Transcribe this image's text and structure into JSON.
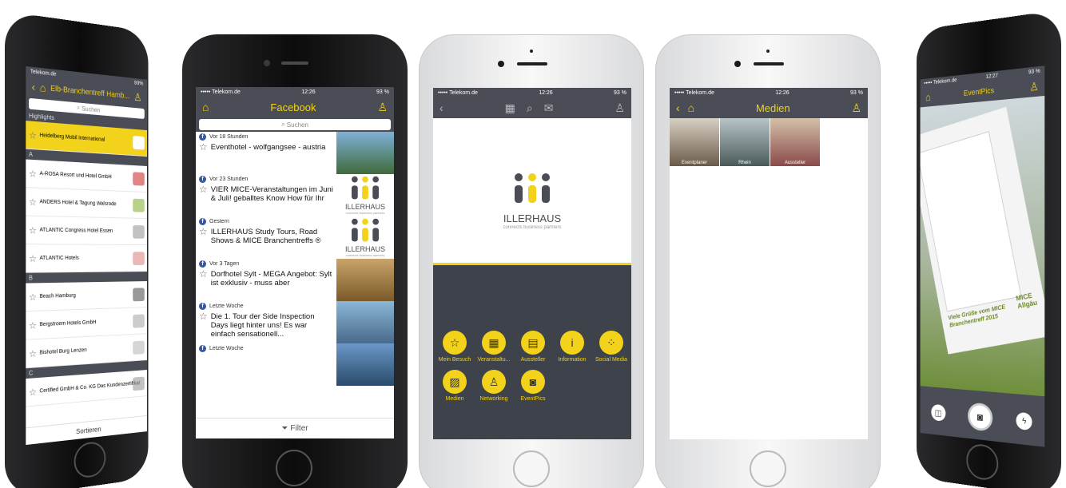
{
  "phone1": {
    "status_carrier": "Telekom.de",
    "status_battery": "93%",
    "nav_title": "Elb-Branchentreff Hamb...",
    "search_placeholder": "Suchen",
    "sections": [
      {
        "header": "Highlights",
        "items": [
          {
            "name": "Heidelberg Mobil International",
            "selected": true
          }
        ]
      },
      {
        "header": "A",
        "items": [
          {
            "name": "A-ROSA Resort und Hotel GmbH"
          },
          {
            "name": "ANDERS Hotel & Tagung Walsrode"
          },
          {
            "name": "ATLANTIC Congress Hotel Essen"
          },
          {
            "name": "ATLANTIC Hotels"
          }
        ]
      },
      {
        "header": "B",
        "items": [
          {
            "name": "Beach Hamburg"
          },
          {
            "name": "Bergstroem Hotels GmbH"
          },
          {
            "name": "Bishotel Burg Lenzen"
          }
        ]
      },
      {
        "header": "C",
        "items": [
          {
            "name": "Certified GmbH & Co. KG Das Kundenzertifikat"
          }
        ]
      }
    ],
    "footer": "Sortieren"
  },
  "phone2": {
    "status_carrier": "••••• Telekom.de",
    "status_time": "12:26",
    "status_battery": "93 %",
    "nav_title": "Facebook",
    "search_placeholder": "Suchen",
    "posts": [
      {
        "time": "Vor 18 Stunden",
        "text": "Eventhotel - wolfgangsee - austria"
      },
      {
        "time": "Vor 23 Stunden",
        "text": "VIER MICE-Veranstaltungen im Juni & Juli! geballtes Know How für Ihr"
      },
      {
        "time": "Gestern",
        "text": "ILLERHAUS Study Tours, Road Shows & MICE Branchentreffs ®"
      },
      {
        "time": "Vor 3 Tagen",
        "text": "Dorfhotel Sylt - MEGA Angebot: Sylt ist exklusiv - muss aber"
      },
      {
        "time": "Letzte Woche",
        "text": "Die 1. Tour der Side Inspection Days liegt hinter uns! Es war einfach sensationell..."
      },
      {
        "time": "Letzte Woche",
        "text": ""
      }
    ],
    "logo_text": "ILLERHAUS",
    "logo_sub": "connects business partners",
    "filter_label": "Filter"
  },
  "phone3": {
    "status_carrier": "••••• Telekom.de",
    "status_time": "12:26",
    "status_battery": "93 %",
    "brand": "ILLERHAUS",
    "tagline": "connects business partners",
    "menu": [
      "Mein Besuch",
      "Veranstaltu...",
      "Aussteller",
      "Information",
      "Social Media",
      "Medien",
      "Networking",
      "EventPics"
    ]
  },
  "phone4": {
    "status_carrier": "••••• Telekom.de",
    "status_time": "12:26",
    "status_battery": "93 %",
    "nav_title": "Medien",
    "tiles": [
      "Eventplaner",
      "Rhein",
      "Aussteller"
    ]
  },
  "phone5": {
    "status_carrier": "••••• Telekom.de",
    "status_time": "12:27",
    "status_battery": "93 %",
    "nav_title": "EventPics",
    "frame_text": "Viele Grüße vom MICE Branchentreff 2015",
    "frame_logo": "MICE Allgäu"
  },
  "colors": {
    "accent": "#f2d21a",
    "bar": "#4a4d55",
    "facebook": "#3b5998"
  }
}
